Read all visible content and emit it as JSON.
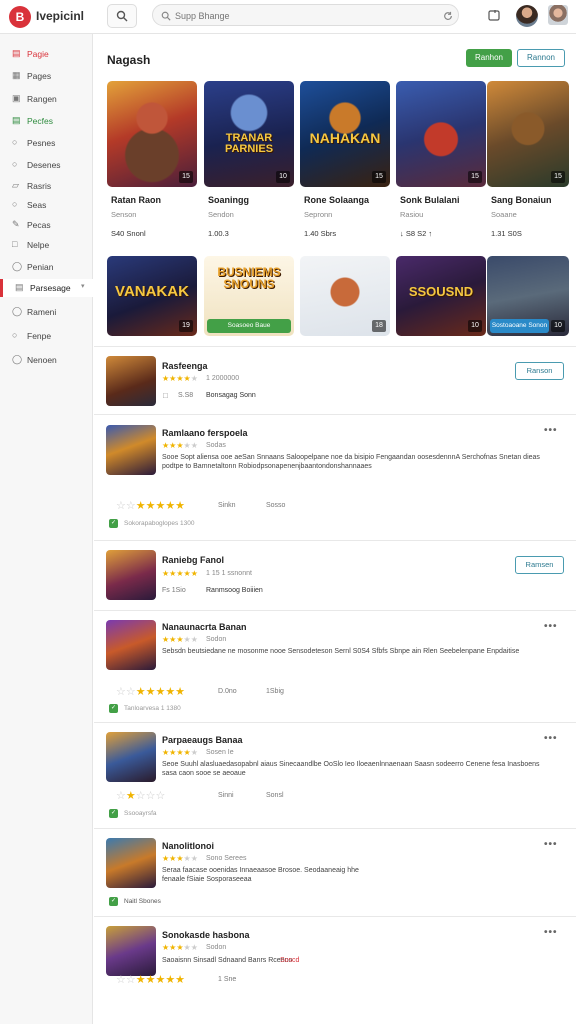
{
  "app": {
    "logo_text": "B",
    "brand": "Ivepicinl"
  },
  "search": {
    "placeholder": "Supp Bhange"
  },
  "sidebar": {
    "items": [
      {
        "label": "Pagie",
        "icon": "store-icon"
      },
      {
        "label": "Pages",
        "icon": "grid-icon"
      },
      {
        "label": "Rangen",
        "icon": "tag-icon"
      },
      {
        "label": "Pecfes",
        "icon": "chart-icon"
      },
      {
        "label": "Pesnes",
        "icon": "chat-icon"
      },
      {
        "label": "Desenes",
        "icon": "cart-icon"
      },
      {
        "label": "Rasris",
        "icon": "folder-icon"
      },
      {
        "label": "Seas",
        "icon": "user-icon"
      },
      {
        "label": "Pecas",
        "icon": "pen-icon"
      },
      {
        "label": "Nelpe",
        "icon": "box-icon"
      },
      {
        "label": "Penian",
        "icon": "shield-icon"
      },
      {
        "label": "Parsesage",
        "icon": "list-icon"
      },
      {
        "label": "Rameni",
        "icon": "settings-icon"
      },
      {
        "label": "Fenpe",
        "icon": "globe-icon"
      },
      {
        "label": "Nenoen",
        "icon": "info-icon"
      }
    ]
  },
  "main": {
    "title": "Nagash",
    "primary_button": "Ranhon",
    "secondary_button": "Rannon"
  },
  "featured": [
    {
      "name": "Ratan Raon",
      "sub": "Senson",
      "price": "S40 Snonl",
      "badge": "15"
    },
    {
      "name": "Soaningg",
      "sub": "Sendon",
      "price": "1.00.3",
      "badge": "10",
      "art_title": "TRANAR PARNIES"
    },
    {
      "name": "Rone Solaanga",
      "sub": "Sepronn",
      "price": "1.40 Sbrs",
      "badge": "15",
      "art_title": "NAHAKAN"
    },
    {
      "name": "Sonk Bulalani",
      "sub": "Rasiou",
      "price": "↓ S8 S2 ↑",
      "badge": "15"
    },
    {
      "name": "Sang Bonaiun",
      "sub": "Soaane",
      "price": "1.31 S0S",
      "badge": "15"
    }
  ],
  "second_row": [
    {
      "art_title": "VANAKAK",
      "badge": "19"
    },
    {
      "art_title": "BUSNIEMS SNOUNS",
      "pill": "Soasoeo Baue"
    },
    {
      "badge": "18"
    },
    {
      "art_title": "SSOUSND",
      "badge": "10"
    },
    {
      "pill": "Sostoaoane Sonon",
      "badge": "10"
    }
  ],
  "list": [
    {
      "name": "Rasfeenga",
      "rating_meta": "1 2000000",
      "count": "S.S8",
      "note": "Bonsagag Sonn",
      "button": "Ranson"
    },
    {
      "name": "Ramlaano ferspoela",
      "rating_meta": "Sodas",
      "desc": "Sooe Sopt aliensa ooe aeSan Snnaans Saloopelpane noe da bisipio Fengaandan oosesdennnA Serchofnas Snetan dieas podtpe to Bamnetaltonn Robiodpsonapenenjbaantondonshannaaes",
      "big_meta1": "Sinkn",
      "big_meta2": "Sosso",
      "verified": "Sokorapaboglopes  1300"
    },
    {
      "name": "Raniebg Fanol",
      "rating_meta": "1 15 1 ssnonnt",
      "count": "Fs  1Sio",
      "note": "Ranmsoog Boiiien",
      "button": "Ramsen"
    },
    {
      "name": "Nanaunacrta Banan",
      "rating_meta": "Sodon",
      "desc": "Sebsdn beutsiedane ne mosonme nooe Sensodeteson Sernl S0S4 Sfbfs Sbnpe ain Rlen Seebelenpane Enpdaitise",
      "big_meta1": "D.0no",
      "big_meta2": "1Sbig",
      "verified": "Tanloarvesa  1 1380"
    },
    {
      "name": "Parpaeaugs Banaa",
      "rating_meta": "Sosen Ie",
      "desc": "Seoe Suuhl alasluaedasopabnl aiaus Sinecaandlbe OoSlo Ieo Iloeaenlnnaenaan Saasn sodeerro Cenene fesa Inasboens sasa caon sooe se aeoaue",
      "big_meta1": "Sinni",
      "big_meta2": "Sonsl",
      "verified": "Ssooayrsfa"
    },
    {
      "name": "Nanolitlonoi",
      "rating_meta": "Sono Serees",
      "desc": "Seraa faacase ooenidas Innaeaasoe Brosoe. Seodaaneaig hhe fenaale fSiaie Sosporaseeaa",
      "verified": "Naitl Sbones"
    },
    {
      "name": "Sonokasde hasbona",
      "rating_meta": "Sodon",
      "desc": "Saoaisnn Sinsadl Sdnaand Banrs Rcenno",
      "desc_link": "Soscd",
      "big_meta1": "1 Sne"
    }
  ]
}
